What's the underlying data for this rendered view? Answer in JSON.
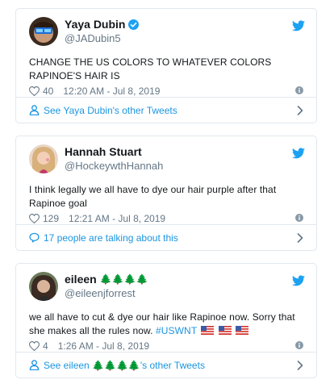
{
  "tweets": [
    {
      "display_name": "Yaya Dubin",
      "handle": "@JADubin5",
      "verified": true,
      "text_line1": "CHANGE THE US COLORS TO WHATEVER COLORS",
      "text_line2": "RAPINOE'S HAIR IS",
      "likes": "40",
      "timestamp": "12:20 AM - Jul 8, 2019",
      "footer_text": "See Yaya Dubin's other Tweets",
      "footer_icon": "person-icon"
    },
    {
      "display_name": "Hannah Stuart",
      "handle": "@HockeywthHannah",
      "verified": false,
      "text_line1": "I think legally we all have to dye our hair purple after that",
      "text_line2": "Rapinoe goal",
      "likes": "129",
      "timestamp": "12:21 AM - Jul 8, 2019",
      "footer_text": "17 people are talking about this",
      "footer_icon": "speech-bubble-icon"
    },
    {
      "display_name": "eileen",
      "name_emoji": "🌲🌲🌲🌲",
      "handle": "@eileenjforrest",
      "verified": false,
      "text_line1": "we all have to cut & dye our hair like Rapinoe now. Sorry that",
      "text_line2": "she makes all the rules now.",
      "hashtag": "#USWNT",
      "likes": "4",
      "timestamp": "1:26 AM - Jul 8, 2019",
      "footer_prefix": "See eileen",
      "footer_emoji": "🌲🌲🌲🌲",
      "footer_suffix": "'s other Tweets",
      "footer_icon": "person-icon"
    }
  ],
  "colors": {
    "twitter_blue": "#1da1f2",
    "link_blue": "#1b95e0",
    "muted_gray": "#657786",
    "border": "#e1e8ed"
  }
}
